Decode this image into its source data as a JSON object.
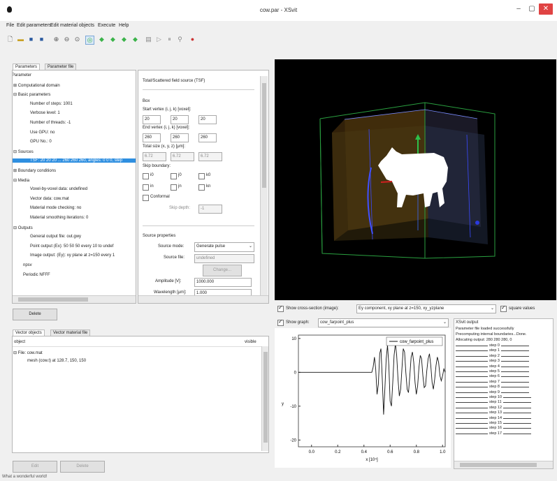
{
  "window": {
    "title": "cow.par - XSvit",
    "min": "–",
    "max": "▢",
    "close": "✕"
  },
  "menu": [
    "File",
    "Edit parameters",
    "Edit material objects",
    "Execute",
    "Help"
  ],
  "toolbar": [
    "new-icon",
    "open-icon",
    "save-icon",
    "save-as-icon",
    "zoom-in-icon",
    "zoom-out-icon",
    "zoom-fit-icon",
    "arrow-left-icon",
    "arrow-right-icon",
    "arrow-up-icon",
    "arrow-down-icon",
    "run-icon",
    "play-icon",
    "pause-icon",
    "view-icon",
    "stop-icon"
  ],
  "params_tabs": [
    "Parameters",
    "Parameter file"
  ],
  "params_tree": [
    {
      "text": "Parameter",
      "x": 16
    },
    {
      "text": "⊞  Computational domain",
      "x": 18
    },
    {
      "text": "⊟  Basic parameters",
      "x": 18
    },
    {
      "text": "Number of steps: 1001",
      "x": 42
    },
    {
      "text": "Verbose level: 1",
      "x": 42
    },
    {
      "text": "Number of threads: -1",
      "x": 42
    },
    {
      "text": "Use GPU: no",
      "x": 42
    },
    {
      "text": "GPU No.: 0",
      "x": 42
    },
    {
      "text": "⊟  Sources",
      "x": 18
    },
    {
      "text": "TSF: 20 20 20 ... 260 260 260, angles: 0 0 0, step",
      "x": 42,
      "selected": true
    },
    {
      "text": "⊞  Boundary conditions",
      "x": 18
    },
    {
      "text": "⊟  Media",
      "x": 18
    },
    {
      "text": "Voxel-by-voxel data: undefined",
      "x": 42
    },
    {
      "text": "Vector data: cow.mat",
      "x": 42
    },
    {
      "text": "Material mode checking: no",
      "x": 42
    },
    {
      "text": "Material smoothing iterations: 0",
      "x": 42
    },
    {
      "text": "⊟  Outputs",
      "x": 18
    },
    {
      "text": "General output file: out.gwy",
      "x": 42
    },
    {
      "text": "Point output (Ex): 50 50 50 every 10 to undef",
      "x": 42
    },
    {
      "text": "Image output: (Ey): xy plane at z=150 every 1",
      "x": 42
    },
    {
      "text": "npsv",
      "x": 32
    },
    {
      "text": "Periodic NFFF",
      "x": 32
    }
  ],
  "params_delete": "Delete",
  "source": {
    "title": "Total/Scattered field source (TSF)",
    "box_label": "Box",
    "start_label": "Start vertex (i, j, k) [voxel]:",
    "start": [
      "20",
      "20",
      "20"
    ],
    "end_label": "End vertex (i, j, k) [voxel]:",
    "end": [
      "260",
      "260",
      "260"
    ],
    "size_label": "Total size (x, y, z) [μm]:",
    "size": [
      "6.72",
      "6.72",
      "6.72"
    ],
    "skip_label": "Skip boundary:",
    "skip": [
      "i0",
      "j0",
      "k0",
      "in",
      "jn",
      "kn"
    ],
    "conformal": "Conformal",
    "skip_depth_label": "Skip depth:",
    "skip_depth": "-1",
    "props_label": "Source properties",
    "mode_label": "Source mode:",
    "mode_value": "Generate pulse",
    "file_label": "Source file:",
    "file_value": "undefined",
    "change": "Change...",
    "amp_label": "Amplitude [V]:",
    "amp_value": "1000.000",
    "wave_label": "Wavelength [μm]:",
    "wave_value": "1.000"
  },
  "vector_tabs": [
    "Vector objects",
    "Vector material file"
  ],
  "vector_header": {
    "object": "object",
    "visible": "visible"
  },
  "vector_rows": [
    {
      "text": "⊟  File: cow.mat",
      "x": 18
    },
    {
      "text": "mesh (cow.t) at 128.7, 150, 150",
      "x": 38
    }
  ],
  "vector_buttons": {
    "edit": "Edit",
    "delete": "Delete"
  },
  "cross_section": {
    "label": "Show cross-section (image):",
    "value": "Ey component, xy plane at z=150, xy_yzplane",
    "square": "square values"
  },
  "graph": {
    "label": "Show graph:",
    "value": "cow_farpoint_plus"
  },
  "output_log": {
    "title": "XSvit output",
    "lines": [
      "Parameter file loaded successfully",
      "Precomputing internal boundaries...Done.",
      "Allocating output: 280 280 280, 0"
    ],
    "steps": [
      "step 0",
      "step 1",
      "step 2",
      "step 3",
      "step 4",
      "step 5",
      "step 6",
      "step 7",
      "step 8",
      "step 9",
      "step 10",
      "step 11",
      "step 12",
      "step 13",
      "step 14",
      "step 15",
      "step 16",
      "step 17"
    ]
  },
  "status": "What a wonderful world!",
  "chart_data": {
    "type": "line",
    "title": "",
    "xlabel": "x [10⁴]",
    "ylabel": "y",
    "xlim": [
      -0.1,
      1.02
    ],
    "ylim": [
      -22,
      11
    ],
    "x_ticks": [
      "0.0",
      "0.2",
      "0.4",
      "0.6",
      "0.8",
      "1.0"
    ],
    "x_tick_values": [
      0,
      0.2,
      0.4,
      0.6,
      0.8,
      1.0
    ],
    "y_ticks": [
      "10",
      "0",
      "-10",
      "-20"
    ],
    "y_tick_values": [
      10,
      0,
      -10,
      -20
    ],
    "grid": false,
    "legend": "top-right",
    "series": [
      {
        "name": "cow_farpoint_plus",
        "x": [
          -0.1,
          0.46,
          0.47,
          0.48,
          0.49,
          0.5,
          0.51,
          0.52,
          0.53,
          0.54,
          0.55,
          0.56,
          0.57,
          0.58,
          0.59,
          0.6,
          0.61,
          0.62,
          0.63,
          0.64,
          0.65,
          0.66,
          0.67,
          0.68,
          0.69,
          0.7,
          0.71,
          0.72,
          0.73,
          0.74,
          0.75,
          0.76,
          0.77,
          0.78,
          0.79,
          0.8,
          0.81,
          0.82,
          0.83,
          0.84,
          0.85,
          0.86,
          0.87,
          0.88,
          0.89,
          0.9,
          0.91,
          0.92,
          0.93,
          0.94,
          0.95,
          0.96,
          0.97,
          0.98,
          0.99,
          1.0,
          1.01,
          1.02
        ],
        "y": [
          0,
          0,
          1.5,
          4.5,
          1.0,
          -6.5,
          -3.5,
          5.5,
          7.0,
          -2.0,
          -12.5,
          -4.5,
          4.0,
          8.0,
          2.0,
          -8.5,
          -10.0,
          -3.0,
          5.0,
          8.5,
          5.0,
          -2.0,
          -7.0,
          -5.0,
          1.0,
          7.0,
          6.0,
          0.0,
          -5.0,
          -6.0,
          -1.0,
          4.5,
          6.0,
          3.0,
          -3.0,
          -6.5,
          -4.0,
          1.5,
          5.0,
          4.0,
          -1.0,
          -4.5,
          -4.0,
          0.5,
          4.0,
          5.5,
          2.0,
          -3.0,
          -5.0,
          -2.0,
          2.0,
          4.5,
          3.0,
          -1.0,
          -2.5,
          -1.0,
          1.0,
          0.0
        ]
      }
    ]
  }
}
